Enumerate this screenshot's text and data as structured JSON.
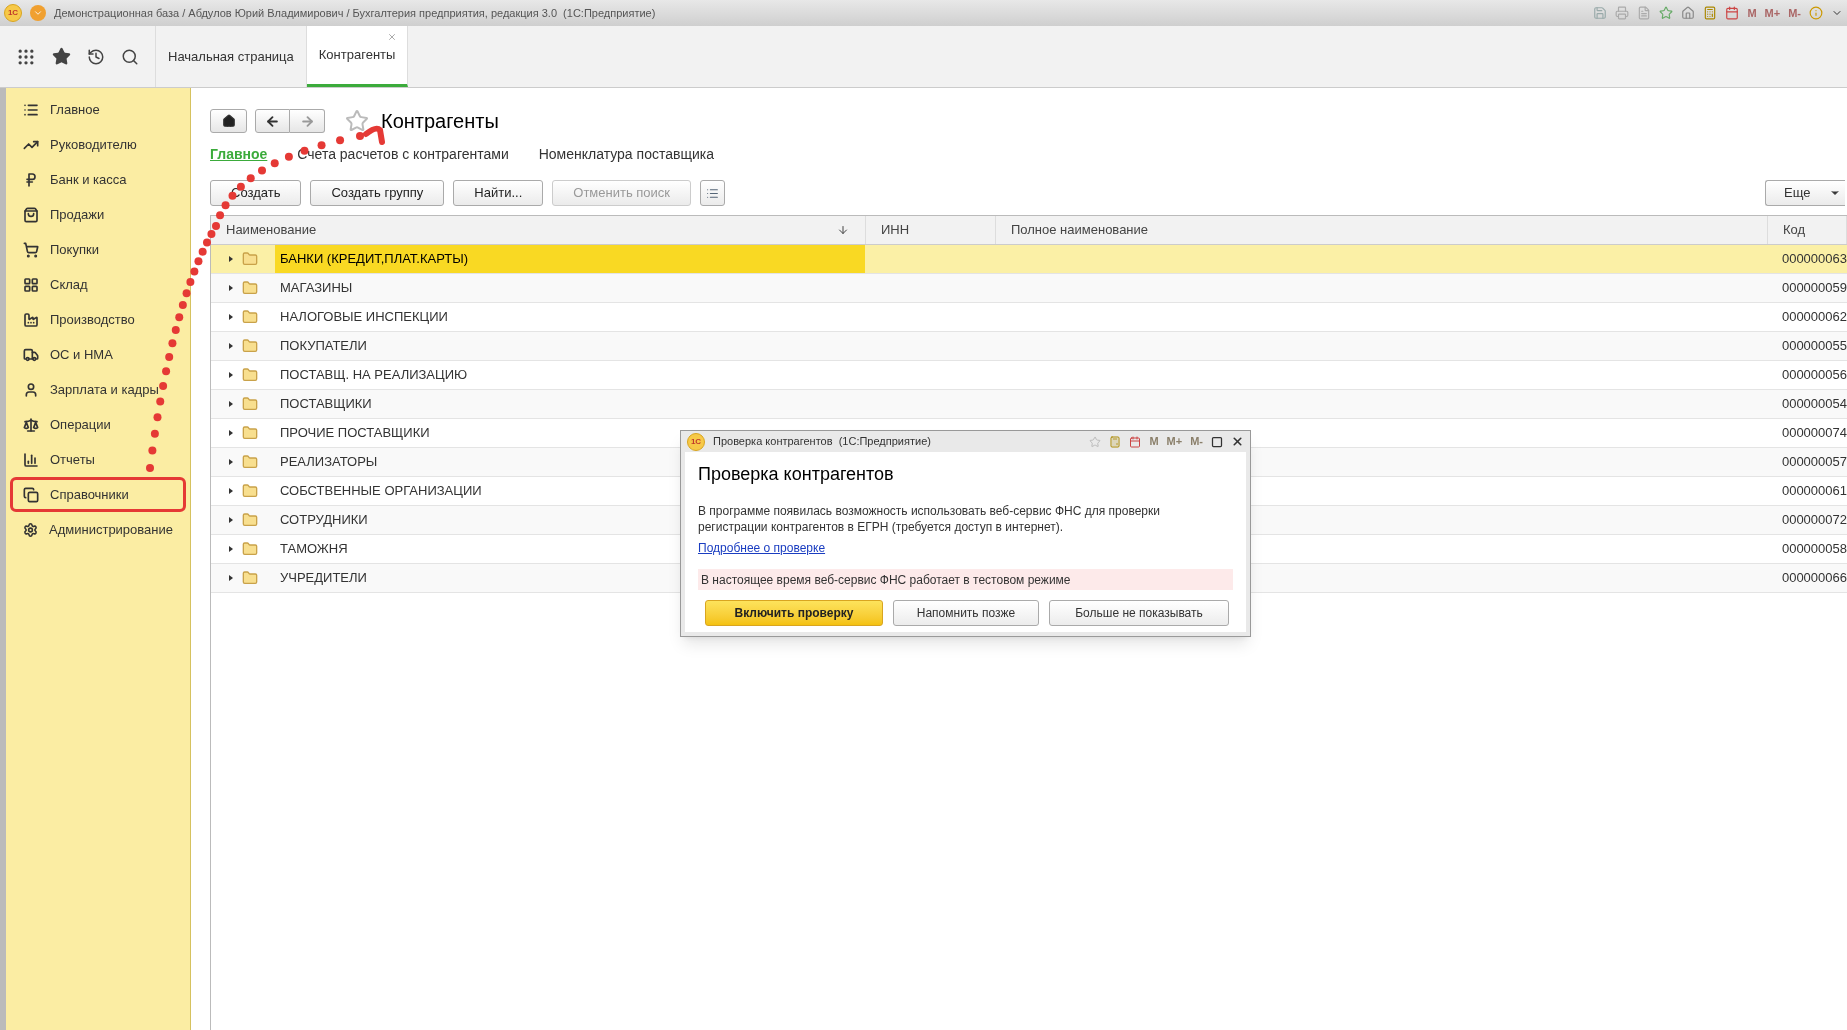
{
  "window": {
    "logo": "1С",
    "title": "Демонстрационная база / Абдулов Юрий Владимирович / Бухгалтерия предприятия, редакция 3.0  (1С:Предприятие)",
    "memory_keys": [
      "M",
      "M+",
      "M-"
    ]
  },
  "tabs": [
    {
      "label": "Начальная страница",
      "selected": false,
      "closable": false
    },
    {
      "label": "Контрагенты",
      "selected": true,
      "closable": true
    }
  ],
  "sidebar": {
    "items": [
      {
        "label": "Главное",
        "kind": "list",
        "highlighted": false
      },
      {
        "label": "Руководителю",
        "kind": "trend",
        "highlighted": false
      },
      {
        "label": "Банк и касса",
        "kind": "ruble",
        "highlighted": false
      },
      {
        "label": "Продажи",
        "kind": "bag",
        "highlighted": false
      },
      {
        "label": "Покупки",
        "kind": "cart",
        "highlighted": false
      },
      {
        "label": "Склад",
        "kind": "grid",
        "highlighted": false
      },
      {
        "label": "Производство",
        "kind": "factory",
        "highlighted": false
      },
      {
        "label": "ОС и НМА",
        "kind": "truck",
        "highlighted": false
      },
      {
        "label": "Зарплата и кадры",
        "kind": "user",
        "highlighted": false
      },
      {
        "label": "Операции",
        "kind": "ledger",
        "highlighted": false
      },
      {
        "label": "Отчеты",
        "kind": "chart",
        "highlighted": false
      },
      {
        "label": "Справочники",
        "kind": "books",
        "highlighted": true
      },
      {
        "label": "Администрирование",
        "kind": "gear",
        "highlighted": false
      }
    ]
  },
  "form": {
    "title": "Контрагенты",
    "links": [
      {
        "label": "Главное",
        "selected": true
      },
      {
        "label": "Счета расчетов с контрагентами",
        "selected": false
      },
      {
        "label": "Номенклатура поставщика",
        "selected": false
      }
    ],
    "buttons": [
      {
        "label": "Создать",
        "disabled": false
      },
      {
        "label": "Создать группу",
        "disabled": false
      },
      {
        "label": "Найти...",
        "disabled": false
      },
      {
        "label": "Отменить поиск",
        "disabled": true
      }
    ],
    "more_button": "Еще"
  },
  "table": {
    "columns": [
      "Наименование",
      "ИНН",
      "Полное наименование",
      "Код"
    ],
    "rows": [
      {
        "name": "БАНКИ (КРЕДИТ,ПЛАТ.КАРТЫ)",
        "code": "000000063",
        "selected": true
      },
      {
        "name": "МАГАЗИНЫ",
        "code": "000000059",
        "selected": false
      },
      {
        "name": "НАЛОГОВЫЕ ИНСПЕКЦИИ",
        "code": "000000062",
        "selected": false
      },
      {
        "name": "ПОКУПАТЕЛИ",
        "code": "000000055",
        "selected": false
      },
      {
        "name": "ПОСТАВЩ. НА РЕАЛИЗАЦИЮ",
        "code": "000000056",
        "selected": false
      },
      {
        "name": "ПОСТАВЩИКИ",
        "code": "000000054",
        "selected": false
      },
      {
        "name": "ПРОЧИЕ ПОСТАВЩИКИ",
        "code": "000000074",
        "selected": false
      },
      {
        "name": "РЕАЛИЗАТОРЫ",
        "code": "000000057",
        "selected": false
      },
      {
        "name": "СОБСТВЕННЫЕ ОРГАНИЗАЦИИ",
        "code": "000000061",
        "selected": false
      },
      {
        "name": "СОТРУДНИКИ",
        "code": "000000072",
        "selected": false
      },
      {
        "name": "ТАМОЖНЯ",
        "code": "000000058",
        "selected": false
      },
      {
        "name": "УЧРЕДИТЕЛИ",
        "code": "000000066",
        "selected": false
      }
    ]
  },
  "dialog": {
    "logo": "1С",
    "title": "Проверка контрагентов  (1С:Предприятие)",
    "memory_keys": [
      "M",
      "M+",
      "M-"
    ],
    "heading": "Проверка контрагентов",
    "text": "В программе появилась возможность использовать веб-сервис ФНС для проверки регистрации контрагентов в ЕГРН (требуется доступ в интернет).",
    "link": "Подробнее о проверке",
    "notice": "В настоящее время веб-сервис ФНС работает в тестовом режиме",
    "buttons": [
      {
        "label": "Включить проверку",
        "primary": true
      },
      {
        "label": "Напомнить позже",
        "primary": false
      },
      {
        "label": "Больше не показывать",
        "primary": false
      }
    ]
  }
}
